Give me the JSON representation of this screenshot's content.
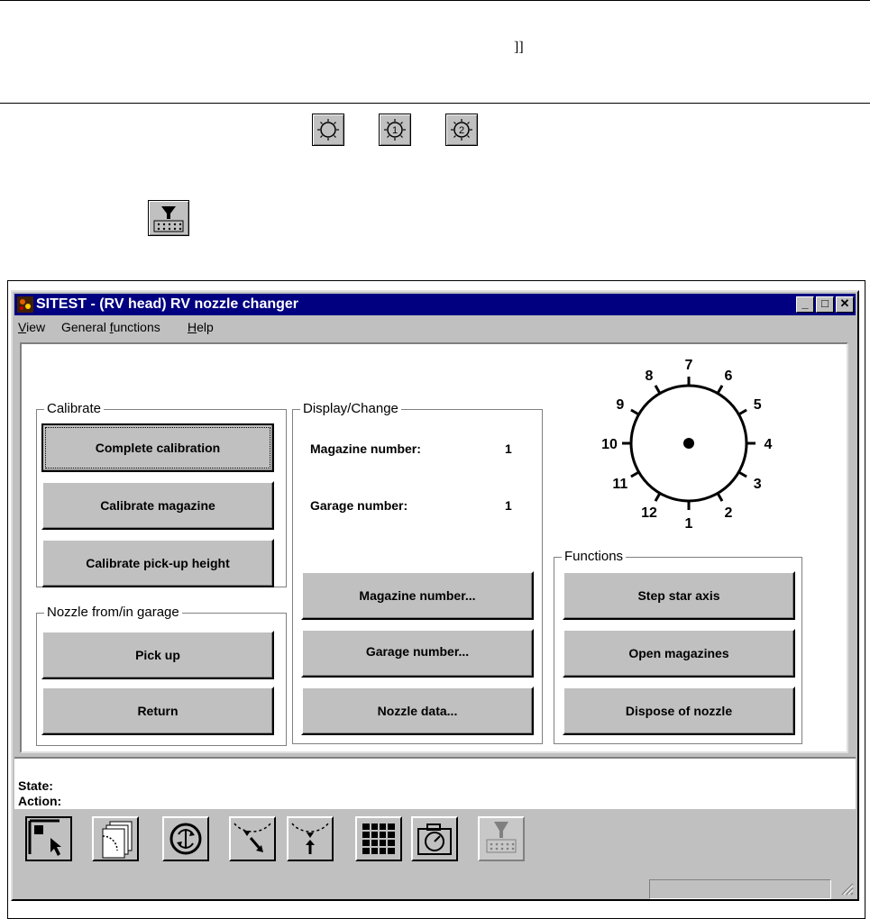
{
  "doc": {
    "bracket": "]]"
  },
  "window": {
    "title": "SITEST - (RV head) RV nozzle changer",
    "controls": {
      "minimize": "_",
      "maximize": "□",
      "close": "✕"
    }
  },
  "menu": [
    {
      "label": "View",
      "mnemonic": "V"
    },
    {
      "label": "General functions",
      "mnemonic": "f"
    },
    {
      "label": "Help",
      "mnemonic": "H"
    }
  ],
  "calibrate": {
    "title": "Calibrate",
    "buttons": [
      "Complete calibration",
      "Calibrate magazine",
      "Calibrate pick-up height"
    ]
  },
  "nozzle_garage": {
    "title": "Nozzle from/in garage",
    "buttons": [
      "Pick up",
      "Return"
    ]
  },
  "display_change": {
    "title": "Display/Change",
    "magazine_label": "Magazine number:",
    "magazine_value": "1",
    "garage_label": "Garage number:",
    "garage_value": "1",
    "buttons": [
      "Magazine number...",
      "Garage number...",
      "Nozzle data..."
    ]
  },
  "dial": {
    "numbers": [
      "1",
      "2",
      "3",
      "4",
      "5",
      "6",
      "7",
      "8",
      "9",
      "10",
      "11",
      "12"
    ]
  },
  "functions": {
    "title": "Functions",
    "buttons": [
      "Step star axis",
      "Open magazines",
      "Dispose of nozzle"
    ]
  },
  "status": {
    "state_label": "State:",
    "action_label": "Action:"
  },
  "colors": {
    "titlebar": "#000080",
    "face": "#c0c0c0"
  }
}
